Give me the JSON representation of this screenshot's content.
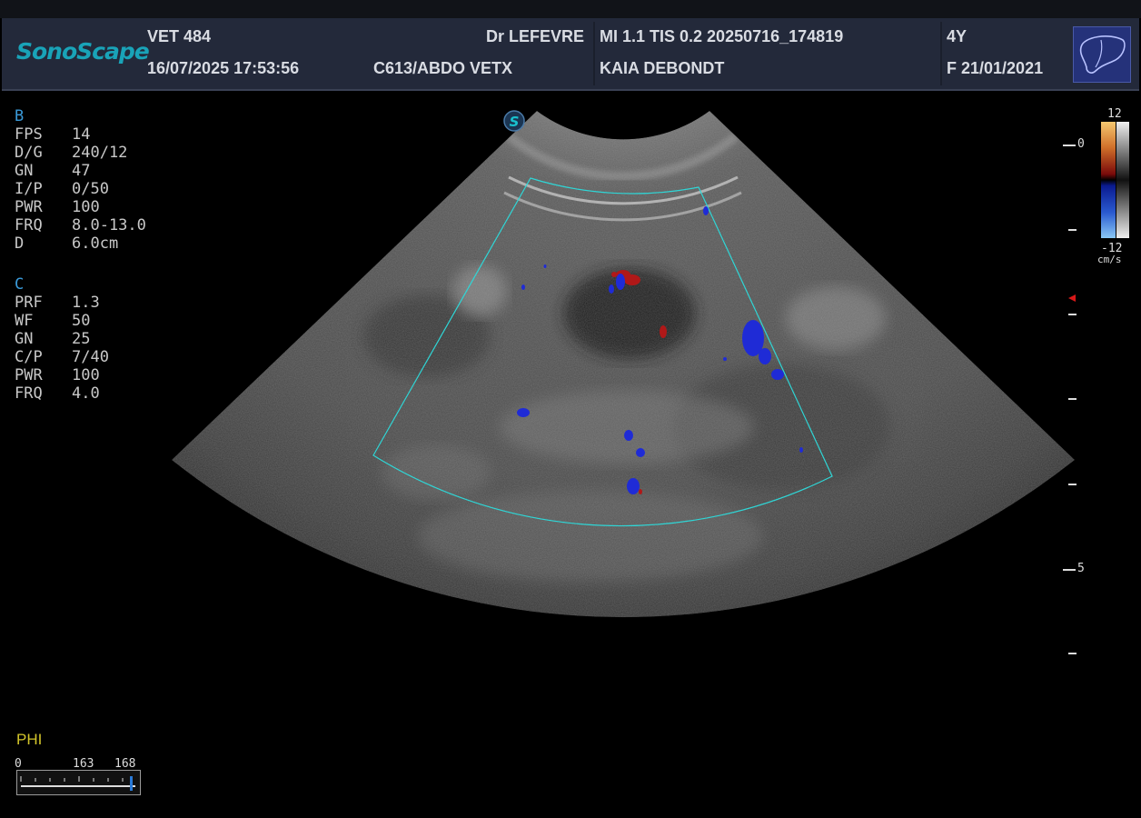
{
  "header": {
    "brand": "SonoScape",
    "patient_id": "VET 484",
    "datetime": "16/07/2025 17:53:56",
    "doctor": "Dr LEFEVRE",
    "probe_preset": "C613/ABDO VETX",
    "mi_tis_file": "MI  1.1   TIS 0.2   20250716_174819",
    "patient_name": "KAIA DEBONDT",
    "age": "4Y",
    "sex_dob": "F   21/01/2021",
    "organ_icon": "liver-icon"
  },
  "b_mode": {
    "header": "B",
    "rows": [
      {
        "label": "FPS",
        "value": "14"
      },
      {
        "label": "D/G",
        "value": "240/12"
      },
      {
        "label": "GN",
        "value": "47"
      },
      {
        "label": "I/P",
        "value": "0/50"
      },
      {
        "label": "PWR",
        "value": "100"
      },
      {
        "label": "FRQ",
        "value": "8.0-13.0"
      },
      {
        "label": "D",
        "value": "6.0cm"
      }
    ]
  },
  "c_mode": {
    "header": "C",
    "rows": [
      {
        "label": "PRF",
        "value": "1.3"
      },
      {
        "label": "WF",
        "value": "50"
      },
      {
        "label": "GN",
        "value": "25"
      },
      {
        "label": "C/P",
        "value": "7/40"
      },
      {
        "label": "PWR",
        "value": "100"
      },
      {
        "label": "FRQ",
        "value": "4.0"
      }
    ]
  },
  "color_scale": {
    "top": "12",
    "bottom": "-12",
    "unit": "cm/s"
  },
  "depth_scale": {
    "zero": "0",
    "five": "5"
  },
  "phi": {
    "label": "PHI",
    "min": "0",
    "mid": "163",
    "max": "168"
  },
  "colors": {
    "brand": "#19a3b8",
    "roi": "#2fd6d6",
    "flow_toward": "#b01818",
    "flow_away": "#1f2bd6",
    "param_header": "#3a9ad9",
    "phi_label": "#d2c42a"
  }
}
